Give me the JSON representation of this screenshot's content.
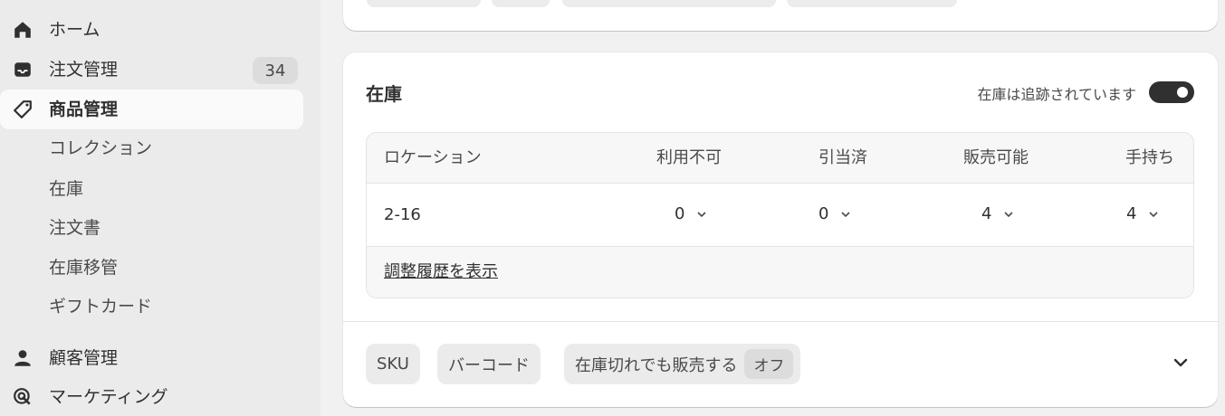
{
  "sidebar": {
    "items": [
      {
        "label": "ホーム",
        "icon": "home-icon"
      },
      {
        "label": "注文管理",
        "icon": "inbox-icon",
        "badge": "34"
      },
      {
        "label": "商品管理",
        "icon": "tag-icon",
        "active": true
      },
      {
        "label": "顧客管理",
        "icon": "person-icon"
      },
      {
        "label": "マーケティング",
        "icon": "target-icon"
      }
    ],
    "subitems": [
      "コレクション",
      "在庫",
      "注文書",
      "在庫移管",
      "ギフトカード"
    ]
  },
  "inventory": {
    "title": "在庫",
    "tracked_label": "在庫は追跡されています",
    "tracked": true,
    "columns": [
      "ロケーション",
      "利用不可",
      "引当済",
      "販売可能",
      "手持ち"
    ],
    "rows": [
      {
        "location": "2-16",
        "unavailable": "0",
        "committed": "0",
        "available": "4",
        "on_hand": "4"
      }
    ],
    "history_link": "調整履歴を表示"
  },
  "chips": {
    "sku": "SKU",
    "barcode": "バーコード",
    "sell_oos": "在庫切れでも販売する",
    "sell_oos_state": "オフ"
  },
  "colors": {
    "accent": "#303030",
    "sidebar_bg": "#ebebeb",
    "card_bg": "#ffffff"
  }
}
